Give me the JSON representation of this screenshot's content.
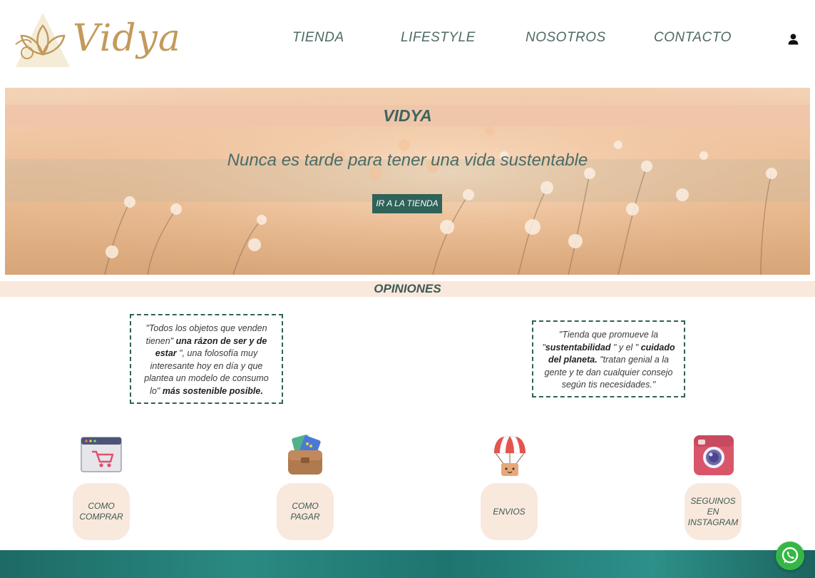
{
  "brand": {
    "name": "Vidya",
    "accent": "#c39a5c"
  },
  "nav": {
    "items": [
      {
        "label": "TIENDA"
      },
      {
        "label": "LIFESTYLE"
      },
      {
        "label": "NOSOTROS"
      },
      {
        "label": "CONTACTO"
      }
    ],
    "account_icon": "user-icon"
  },
  "hero": {
    "title": "VIDYA",
    "tagline": "Nunca es tarde para tener una vida sustentable",
    "button_label": "IR A LA TIENDA",
    "button_color": "#2f6258"
  },
  "opinions": {
    "title": "OPINIONES",
    "quotes": [
      {
        "part1": "\"Todos los objetos que venden tienen\" ",
        "bold1": "una rázon de ser y de estar",
        "part2": " \", una folosofía muy interesante hoy en día y que plantea un modelo de consumo lo\" ",
        "bold2": "más sostenible posible."
      },
      {
        "part1": "\"Tienda que promueve la \"",
        "bold1": "sustentabilidad",
        "part2": " \" y el \" ",
        "bold2": "cuidado del planeta.",
        "part3": " \"tratan genial a la gente y te dan cualquier consejo según tis necesidades.\""
      }
    ]
  },
  "features": [
    {
      "label": "COMO COMPRAR",
      "icon": "shopping-cart-browser-icon"
    },
    {
      "label": "COMO PAGAR",
      "icon": "wallet-icon"
    },
    {
      "label": "ENVIOS",
      "icon": "parachute-box-icon"
    },
    {
      "label": "SEGUINOS EN INSTAGRAM",
      "icon": "instagram-icon"
    }
  ],
  "whatsapp": {
    "icon": "whatsapp-icon",
    "color": "#35b745"
  }
}
